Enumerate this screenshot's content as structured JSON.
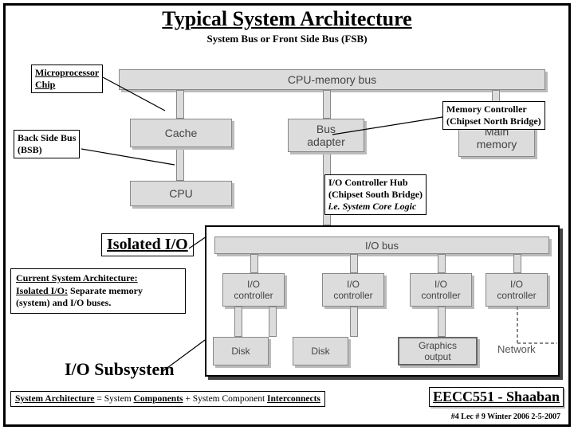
{
  "title": "Typical System Architecture",
  "subtitle": "System Bus  or  Front Side Bus (FSB)",
  "labels": {
    "microchip": "Microprocessor\nChip",
    "bsb": "Back Side Bus\n(BSB)",
    "memctrl": "Memory Controller\n(Chipset North Bridge)",
    "ioctrlhub_l1": "I/O Controller Hub",
    "ioctrlhub_l2": "(Chipset South Bridge)",
    "ioctrlhub_l3": "i.e. System Core Logic",
    "isolated": "Isolated I/O",
    "iosub": "I/O Subsystem"
  },
  "blocks": {
    "cpumem": "CPU-memory bus",
    "cache": "Cache",
    "busadapter": "Bus\nadapter",
    "mainmem": "Main\nmemory",
    "cpu": "CPU",
    "iobus": "I/O bus",
    "ioctrl": "I/O\ncontroller",
    "disk": "Disk",
    "graphics": "Graphics\noutput",
    "network": "Network"
  },
  "callout": {
    "l1": "Current System Architecture:",
    "l2a": "Isolated I/O:",
    "l2b": "   Separate memory",
    "l3": "(system) and I/O buses."
  },
  "bottom": {
    "arch_pre": "System Architecture",
    "arch_mid": " =  System ",
    "arch_comp": "Components",
    "arch_plus": " + System Component ",
    "arch_inter": "Interconnects",
    "course": "EECC551 - Shaaban",
    "footer": "#4   Lec # 9   Winter 2006  2-5-2007"
  }
}
